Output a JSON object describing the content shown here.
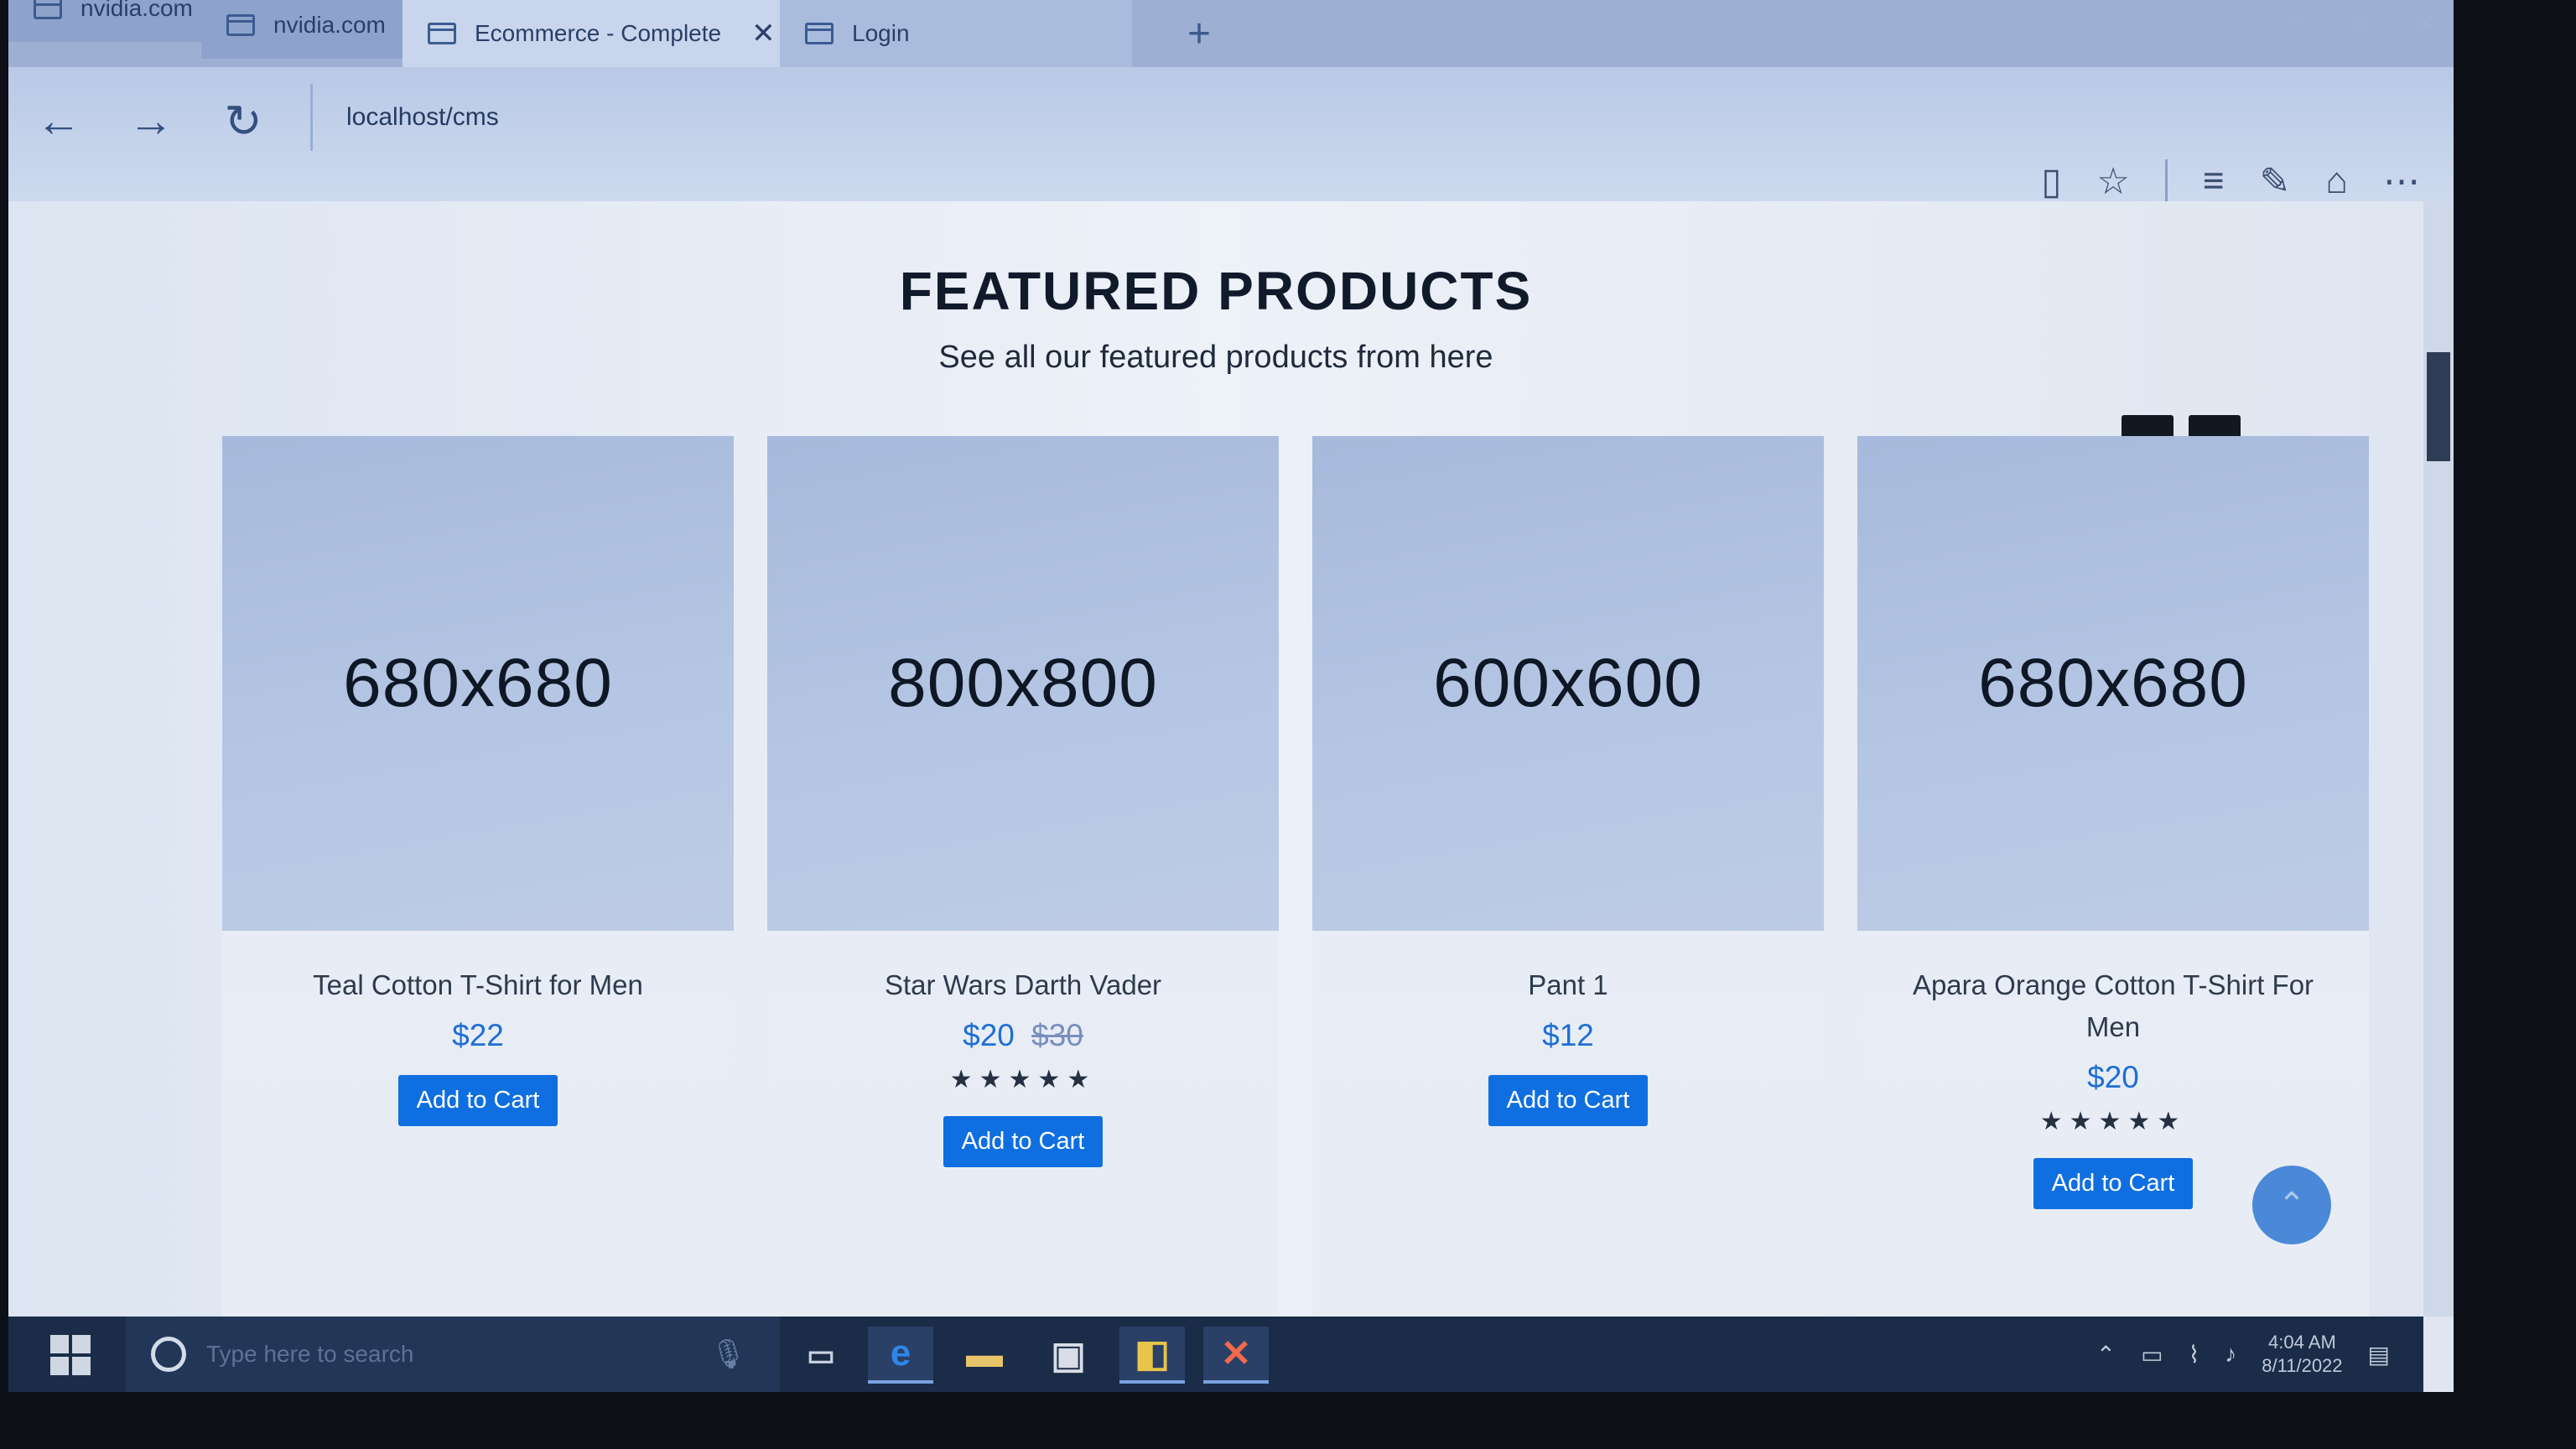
{
  "browser": {
    "tabs": [
      {
        "label": "nvidia.com"
      },
      {
        "label": "nvidia.com"
      },
      {
        "label": "Ecommerce - Complete"
      },
      {
        "label": "Login"
      }
    ],
    "url": "localhost/cms"
  },
  "page": {
    "title": "FEATURED PRODUCTS",
    "subtitle": "See all our featured products from here",
    "prev_label": "‹",
    "next_label": "›",
    "add_to_cart": "Add to Cart",
    "products": [
      {
        "image_size": "680x680",
        "name": "Teal Cotton T-Shirt for Men",
        "price": "$22",
        "old_price": "",
        "rating": 0
      },
      {
        "image_size": "800x800",
        "name": "Star Wars Darth Vader",
        "price": "$20",
        "old_price": "$30",
        "rating": 5
      },
      {
        "image_size": "600x600",
        "name": "Pant 1",
        "price": "$12",
        "old_price": "",
        "rating": 0
      },
      {
        "image_size": "680x680",
        "name": "Apara Orange Cotton T-Shirt For Men",
        "price": "$20",
        "old_price": "",
        "rating": 5
      }
    ]
  },
  "taskbar": {
    "search_placeholder": "Type here to search",
    "time": "4:04 AM",
    "date": "8/11/2022"
  }
}
